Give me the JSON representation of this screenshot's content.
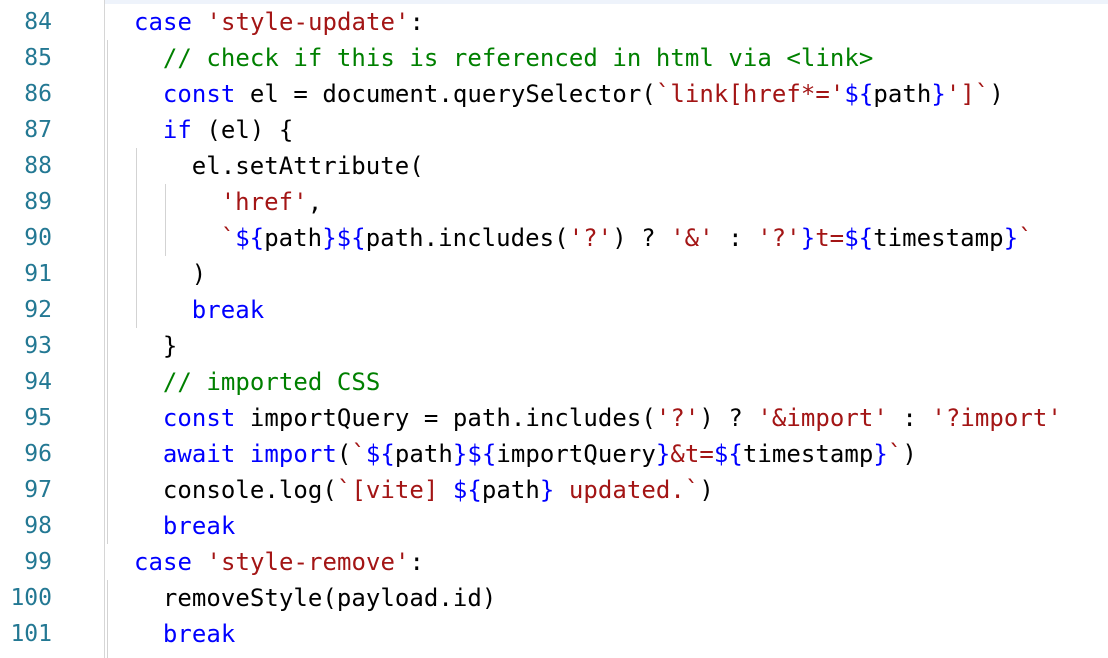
{
  "editor": {
    "lines": [
      {
        "number": "84",
        "indent": 2,
        "tokens": [
          {
            "t": "kw",
            "v": "case"
          },
          {
            "t": "plain",
            "v": " "
          },
          {
            "t": "str",
            "v": "'style-update'"
          },
          {
            "t": "plain",
            "v": ":"
          }
        ]
      },
      {
        "number": "85",
        "indent": 3,
        "tokens": [
          {
            "t": "cm",
            "v": "// check if this is referenced in html via <link>"
          }
        ]
      },
      {
        "number": "86",
        "indent": 3,
        "tokens": [
          {
            "t": "kw",
            "v": "const"
          },
          {
            "t": "plain",
            "v": " el = document.querySelector("
          },
          {
            "t": "str",
            "v": "`link[href*='"
          },
          {
            "t": "tpl",
            "v": "${"
          },
          {
            "t": "plain",
            "v": "path"
          },
          {
            "t": "tpl",
            "v": "}"
          },
          {
            "t": "str",
            "v": "']`"
          },
          {
            "t": "plain",
            "v": ")"
          }
        ]
      },
      {
        "number": "87",
        "indent": 3,
        "tokens": [
          {
            "t": "kw",
            "v": "if"
          },
          {
            "t": "plain",
            "v": " (el) {"
          }
        ]
      },
      {
        "number": "88",
        "indent": 4,
        "tokens": [
          {
            "t": "plain",
            "v": "el.setAttribute("
          }
        ]
      },
      {
        "number": "89",
        "indent": 5,
        "tokens": [
          {
            "t": "str",
            "v": "'href'"
          },
          {
            "t": "plain",
            "v": ","
          }
        ]
      },
      {
        "number": "90",
        "indent": 5,
        "tokens": [
          {
            "t": "str",
            "v": "`"
          },
          {
            "t": "tpl",
            "v": "${"
          },
          {
            "t": "plain",
            "v": "path"
          },
          {
            "t": "tpl",
            "v": "}${"
          },
          {
            "t": "plain",
            "v": "path.includes("
          },
          {
            "t": "str",
            "v": "'?'"
          },
          {
            "t": "plain",
            "v": ") ? "
          },
          {
            "t": "str",
            "v": "'&'"
          },
          {
            "t": "plain",
            "v": " : "
          },
          {
            "t": "str",
            "v": "'?'"
          },
          {
            "t": "tpl",
            "v": "}"
          },
          {
            "t": "str",
            "v": "t="
          },
          {
            "t": "tpl",
            "v": "${"
          },
          {
            "t": "plain",
            "v": "timestamp"
          },
          {
            "t": "tpl",
            "v": "}"
          },
          {
            "t": "str",
            "v": "`"
          }
        ]
      },
      {
        "number": "91",
        "indent": 4,
        "tokens": [
          {
            "t": "plain",
            "v": ")"
          }
        ]
      },
      {
        "number": "92",
        "indent": 4,
        "tokens": [
          {
            "t": "kw",
            "v": "break"
          }
        ]
      },
      {
        "number": "93",
        "indent": 3,
        "tokens": [
          {
            "t": "plain",
            "v": "}"
          }
        ]
      },
      {
        "number": "94",
        "indent": 3,
        "tokens": [
          {
            "t": "cm",
            "v": "// imported CSS"
          }
        ]
      },
      {
        "number": "95",
        "indent": 3,
        "tokens": [
          {
            "t": "kw",
            "v": "const"
          },
          {
            "t": "plain",
            "v": " importQuery = path.includes("
          },
          {
            "t": "str",
            "v": "'?'"
          },
          {
            "t": "plain",
            "v": ") ? "
          },
          {
            "t": "str",
            "v": "'&import'"
          },
          {
            "t": "plain",
            "v": " : "
          },
          {
            "t": "str",
            "v": "'?import'"
          }
        ]
      },
      {
        "number": "96",
        "indent": 3,
        "tokens": [
          {
            "t": "kw",
            "v": "await"
          },
          {
            "t": "plain",
            "v": " "
          },
          {
            "t": "kw",
            "v": "import"
          },
          {
            "t": "plain",
            "v": "("
          },
          {
            "t": "str",
            "v": "`"
          },
          {
            "t": "tpl",
            "v": "${"
          },
          {
            "t": "plain",
            "v": "path"
          },
          {
            "t": "tpl",
            "v": "}${"
          },
          {
            "t": "plain",
            "v": "importQuery"
          },
          {
            "t": "tpl",
            "v": "}"
          },
          {
            "t": "str",
            "v": "&t="
          },
          {
            "t": "tpl",
            "v": "${"
          },
          {
            "t": "plain",
            "v": "timestamp"
          },
          {
            "t": "tpl",
            "v": "}"
          },
          {
            "t": "str",
            "v": "`"
          },
          {
            "t": "plain",
            "v": ")"
          }
        ]
      },
      {
        "number": "97",
        "indent": 3,
        "tokens": [
          {
            "t": "plain",
            "v": "console.log("
          },
          {
            "t": "str",
            "v": "`[vite] "
          },
          {
            "t": "tpl",
            "v": "${"
          },
          {
            "t": "plain",
            "v": "path"
          },
          {
            "t": "tpl",
            "v": "}"
          },
          {
            "t": "str",
            "v": " updated.`"
          },
          {
            "t": "plain",
            "v": ")"
          }
        ]
      },
      {
        "number": "98",
        "indent": 3,
        "tokens": [
          {
            "t": "kw",
            "v": "break"
          }
        ]
      },
      {
        "number": "99",
        "indent": 2,
        "tokens": [
          {
            "t": "kw",
            "v": "case"
          },
          {
            "t": "plain",
            "v": " "
          },
          {
            "t": "str",
            "v": "'style-remove'"
          },
          {
            "t": "plain",
            "v": ":"
          }
        ]
      },
      {
        "number": "100",
        "indent": 3,
        "tokens": [
          {
            "t": "plain",
            "v": "removeStyle(payload.id)"
          }
        ]
      },
      {
        "number": "101",
        "indent": 3,
        "tokens": [
          {
            "t": "kw",
            "v": "break"
          }
        ]
      }
    ]
  },
  "colors": {
    "keyword": "#0000ff",
    "string": "#a31515",
    "comment": "#008000",
    "line_number": "#237893",
    "text": "#000000",
    "background": "#ffffff"
  }
}
